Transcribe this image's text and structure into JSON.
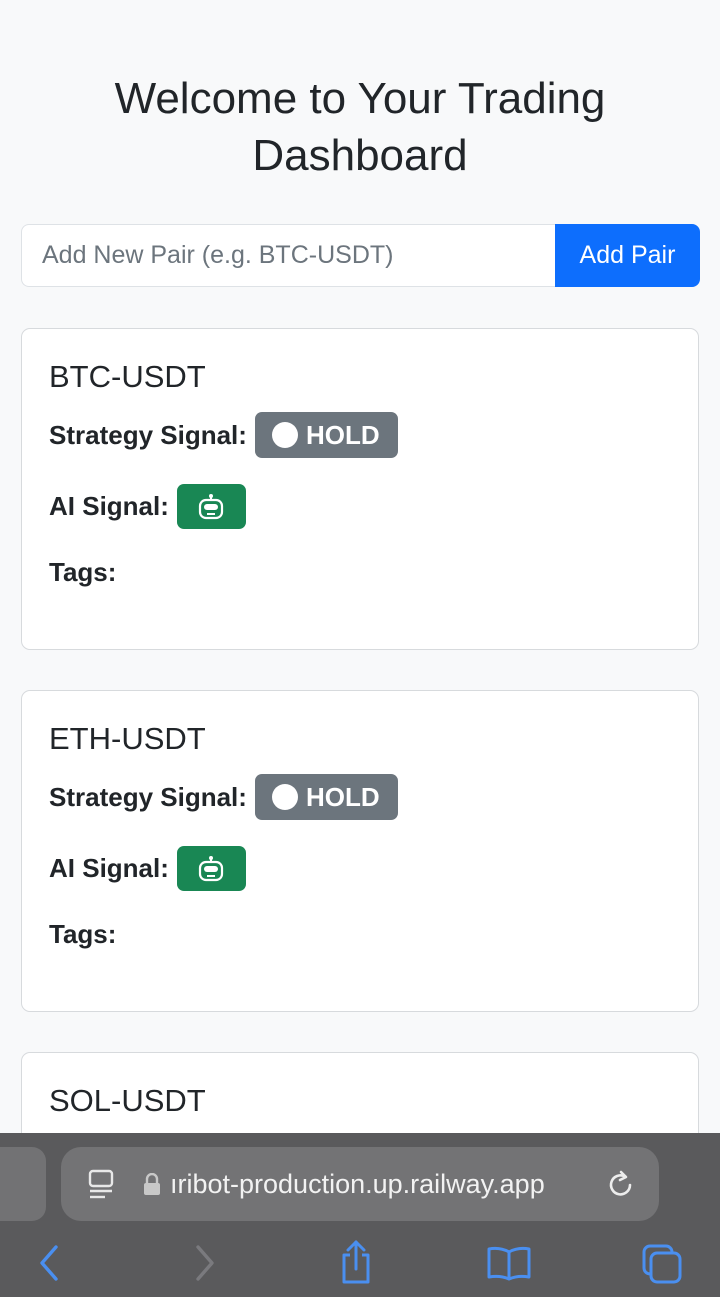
{
  "page": {
    "title": "Welcome to Your Trading Dashboard"
  },
  "add_pair": {
    "placeholder": "Add New Pair (e.g. BTC-USDT)",
    "button_label": "Add Pair"
  },
  "labels": {
    "strategy": "Strategy Signal:",
    "ai": "AI Signal:",
    "tags": "Tags:"
  },
  "pairs": [
    {
      "name": "BTC-USDT",
      "strategy_signal": "HOLD"
    },
    {
      "name": "ETH-USDT",
      "strategy_signal": "HOLD"
    },
    {
      "name": "SOL-USDT"
    }
  ],
  "browser": {
    "url": "ıribot-production.up.railway.app"
  },
  "colors": {
    "primary": "#0d6efd",
    "hold": "#6c757d",
    "ai": "#198754",
    "browser_accent": "#4a8ff0"
  }
}
